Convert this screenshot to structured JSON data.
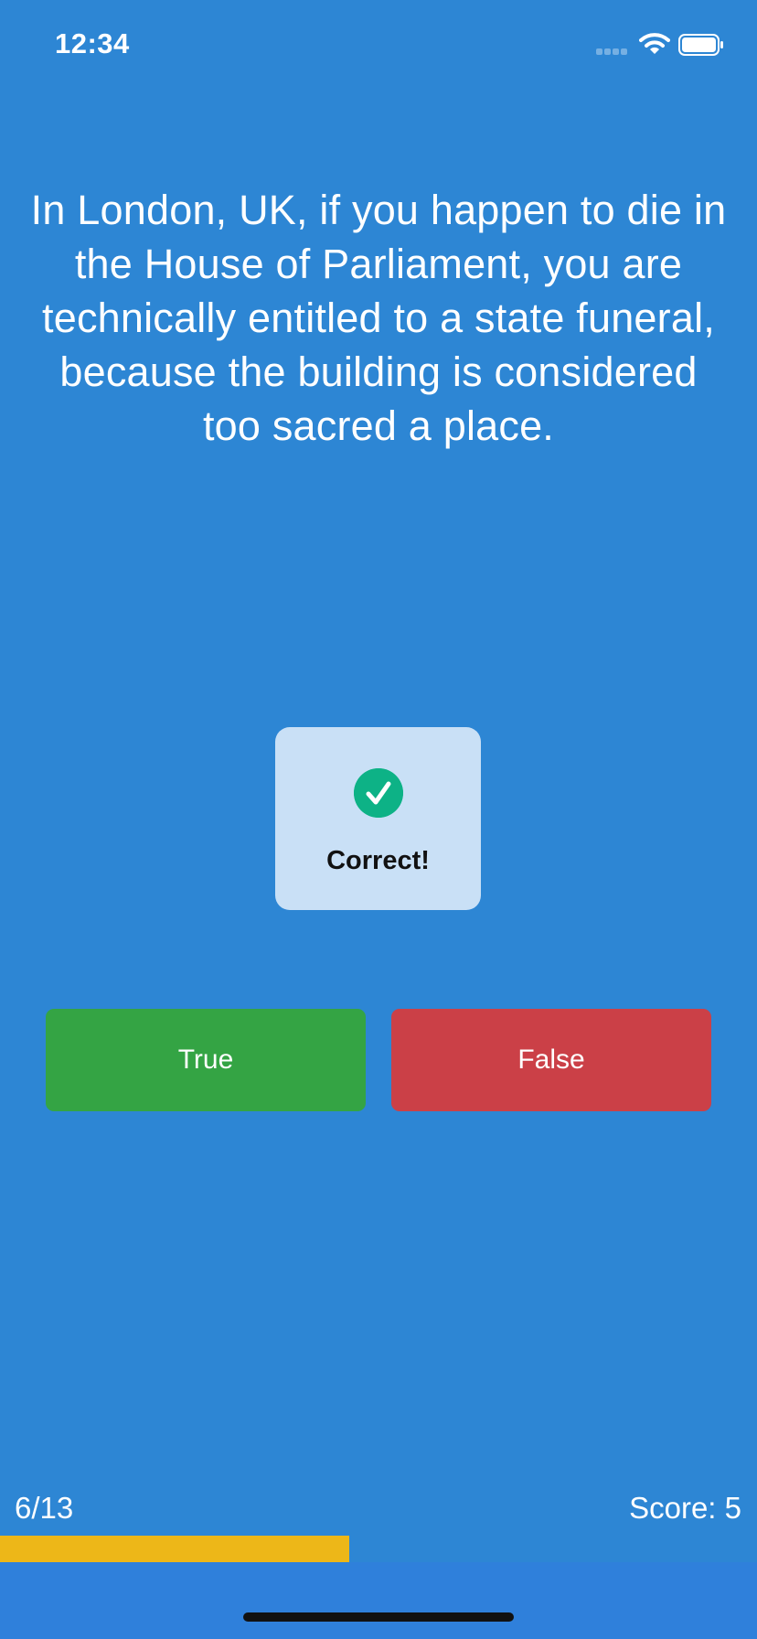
{
  "status_bar": {
    "time": "12:34",
    "icons": [
      "cellular-signal-icon",
      "wifi-icon",
      "battery-icon"
    ]
  },
  "question": {
    "text": "In London, UK, if you happen to die in the House of Parliament, you are technically entitled to a state funeral, because the building is considered too sacred a place."
  },
  "feedback": {
    "icon": "checkmark-circle-icon",
    "label": "Correct!"
  },
  "answers": {
    "true_label": "True",
    "false_label": "False"
  },
  "footer": {
    "progress_label": "6/13",
    "score_label": "Score: 5",
    "progress": {
      "current": 6,
      "total": 13
    }
  },
  "colors": {
    "background": "#2D86D4",
    "true_button": "#34A444",
    "false_button": "#CB4047",
    "progress_fill": "#EDB718",
    "hud_background": "#C9E0F6",
    "check_circle": "#0DB286"
  }
}
